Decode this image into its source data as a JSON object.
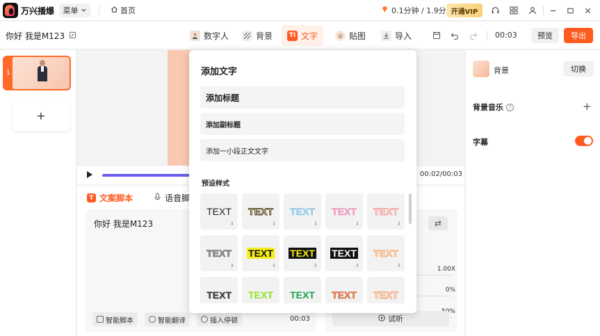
{
  "app": {
    "name": "万兴播爆"
  },
  "topbar": {
    "menu_label": "菜单",
    "home_label": "首页",
    "credits": "0.1分钟 / 1.9分钟",
    "vip_label": "开通VIP"
  },
  "project": {
    "title": "你好 我是M123"
  },
  "tabs": [
    {
      "label": "数字人",
      "icon": "avatar-icon"
    },
    {
      "label": "背景",
      "icon": "background-icon"
    },
    {
      "label": "文字",
      "icon": "text-icon",
      "active": true
    },
    {
      "label": "贴图",
      "icon": "sticker-icon"
    },
    {
      "label": "导入",
      "icon": "import-icon"
    }
  ],
  "toolbar": {
    "duration": "00:03",
    "preview_label": "预览",
    "export_label": "导出"
  },
  "scenes": {
    "items": [
      {
        "number": "1"
      }
    ],
    "add_label": "+"
  },
  "player": {
    "time": "00:02/00:03",
    "progress": 1.0
  },
  "script": {
    "tabs": [
      {
        "label": "文案脚本",
        "active": true
      },
      {
        "label": "语音脚"
      }
    ],
    "text": "你好 我是M123",
    "buttons": [
      "智能脚本",
      "智能翻译",
      "插入停顿"
    ],
    "duration": "00:03",
    "voice_params": [
      "1.00X",
      "0%",
      "50%"
    ],
    "listen_label": "试听"
  },
  "props": {
    "background_label": "背景",
    "switch_label": "切换",
    "bgm_label": "背景音乐",
    "subtitle_label": "字幕",
    "subtitle_on": true
  },
  "popover": {
    "title": "添加文字",
    "add_title": "添加标题",
    "add_subtitle": "添加副标题",
    "add_body": "添加一小段正文文字",
    "preset_label": "预设样式",
    "preset_text": "TEXT",
    "accent": "#ff5a1f"
  }
}
